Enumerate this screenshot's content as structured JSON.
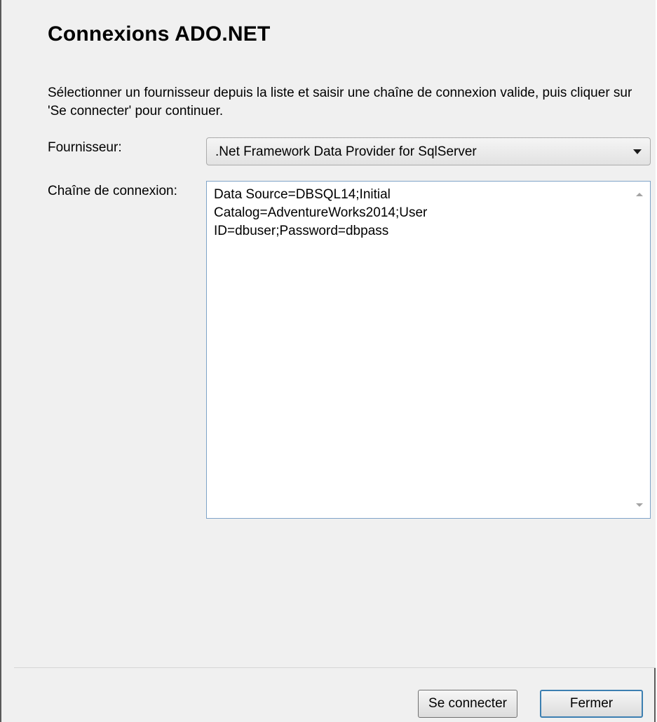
{
  "dialog": {
    "title": "Connexions ADO.NET",
    "description": "Sélectionner un fournisseur depuis la liste et saisir une chaîne de connexion valide, puis cliquer sur 'Se connecter' pour continuer."
  },
  "provider": {
    "label": "Fournisseur:",
    "selected": ".Net Framework Data Provider for SqlServer"
  },
  "connection_string": {
    "label": "Chaîne de connexion:",
    "value": "Data Source=DBSQL14;Initial\nCatalog=AdventureWorks2014;User\nID=dbuser;Password=dbpass"
  },
  "buttons": {
    "connect": "Se connecter",
    "close": "Fermer"
  }
}
